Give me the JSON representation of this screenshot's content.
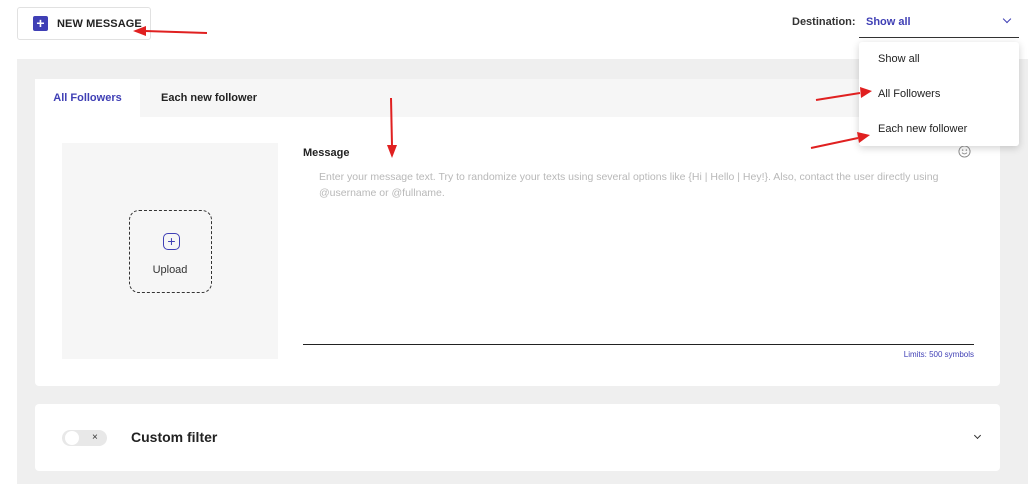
{
  "toolbar": {
    "new_message_label": "NEW MESSAGE",
    "destination_label": "Destination:",
    "destination_value": "Show all"
  },
  "dropdown": {
    "options": [
      "Show all",
      "All Followers",
      "Each new follower"
    ]
  },
  "tabs": [
    {
      "label": "All Followers",
      "active": true
    },
    {
      "label": "Each new follower",
      "active": false
    }
  ],
  "upload": {
    "label": "Upload"
  },
  "message": {
    "title": "Message",
    "placeholder": "Enter your message text. Try to randomize your texts using several options like {Hi | Hello | Hey!}. Also, contact the user directly using @username or @fullname.",
    "limits": "Limits: 500 symbols"
  },
  "filter": {
    "title": "Custom filter",
    "toggle_glyph": "×",
    "enabled": false
  },
  "icons": [
    "plus-icon",
    "chevron-down-icon",
    "upload-plus-icon",
    "smiley-icon",
    "close-icon"
  ],
  "colors": {
    "accent": "#3f3fb5",
    "annotation": "#e02020",
    "background": "#efefef"
  }
}
